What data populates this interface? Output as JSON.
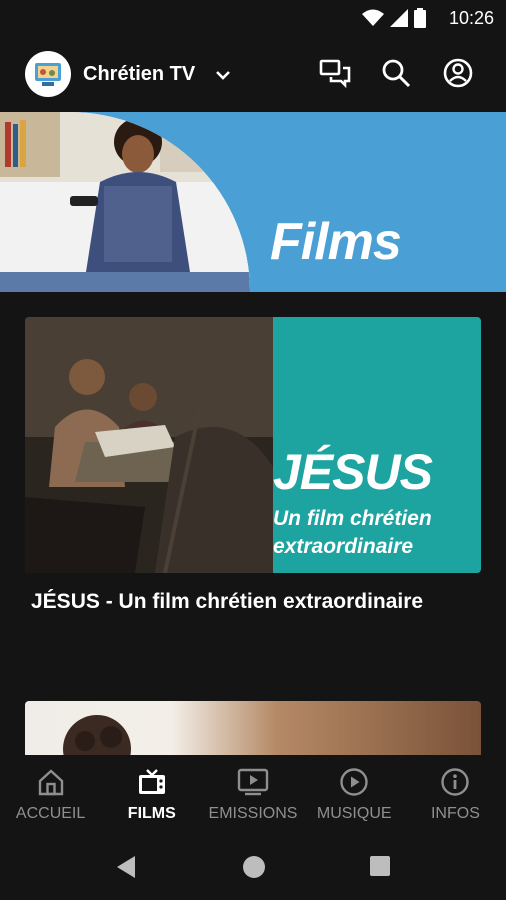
{
  "status_bar": {
    "time": "10:26"
  },
  "app_bar": {
    "title": "Chrétien TV"
  },
  "hero": {
    "text": "Films"
  },
  "featured": {
    "headline": "JÉSUS",
    "tagline_1": "Un film chrétien",
    "tagline_2": "extraordinaire",
    "title": "JÉSUS - Un film chrétien extraordinaire"
  },
  "bottom_nav": {
    "items": [
      {
        "label": "ACCUEIL",
        "icon": "home-icon",
        "active": false
      },
      {
        "label": "FILMS",
        "icon": "tv-icon",
        "active": true
      },
      {
        "label": "EMISSIONS",
        "icon": "monitor-play-icon",
        "active": false
      },
      {
        "label": "MUSIQUE",
        "icon": "play-circle-icon",
        "active": false
      },
      {
        "label": "INFOS",
        "icon": "info-icon",
        "active": false
      }
    ]
  },
  "colors": {
    "background": "#141414",
    "accent_blue": "#4aa0d5",
    "accent_teal": "#1ea4a0",
    "inactive": "#8f8f8f"
  }
}
